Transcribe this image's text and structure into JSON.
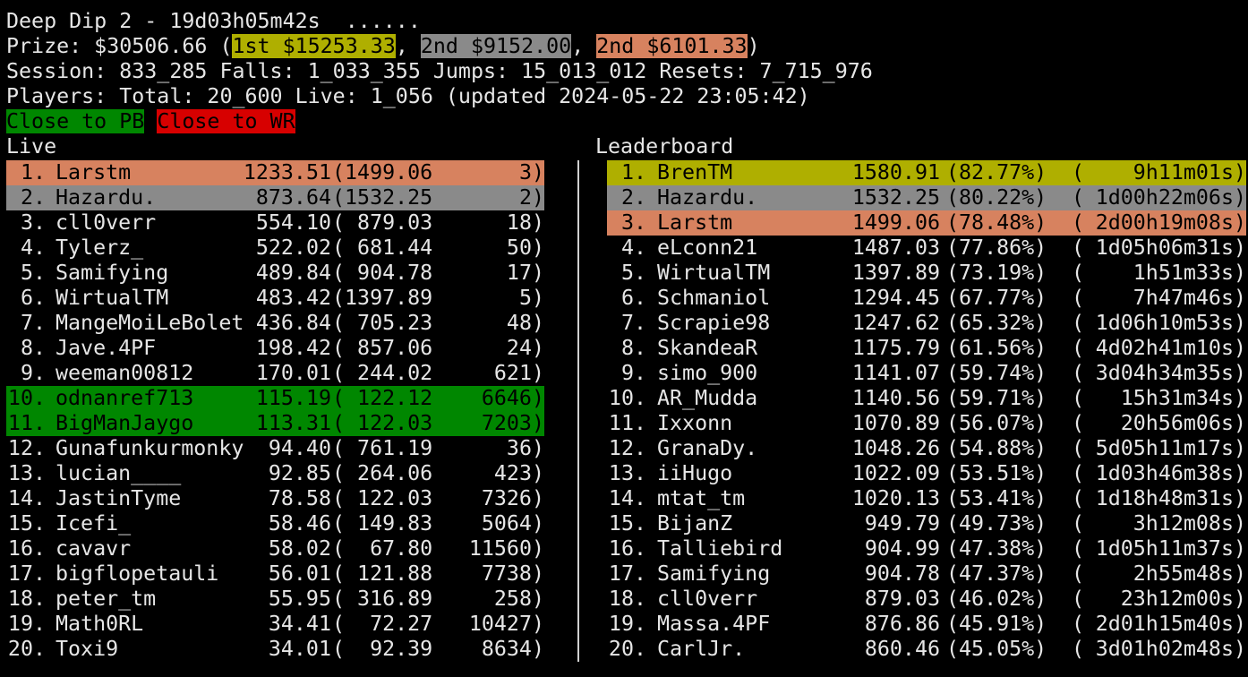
{
  "header": {
    "title": "Deep Dip 2 - 19d03h05m42s  ......",
    "prize_prefix": "Prize: $30506.66 (",
    "prize_first": "1st $15253.33",
    "prize_sep1": ", ",
    "prize_second": "2nd $9152.00",
    "prize_sep2": ", ",
    "prize_third": "2nd $6101.33",
    "prize_suffix": ")",
    "stats": "Session: 833_285 Falls: 1_033_355 Jumps: 15_013_012 Resets: 7_715_976",
    "players": "Players: Total: 20_600 Live: 1_056 (updated 2024-05-22 23:05:42)",
    "legend_pb": "Close to PB",
    "legend_wr": "Close to WR"
  },
  "colors": {
    "gold": "#afaf00",
    "silver": "#8a8a8a",
    "bronze": "#d7825f",
    "green": "#008700",
    "red": "#d70000",
    "text": "#e6e6e6",
    "background": "#000000"
  },
  "live": {
    "title": "Live",
    "rows": [
      {
        "rank": " 1.",
        "name": "Larstm",
        "height": "1233.51",
        "pb": "(1499.06",
        "falls": "3)",
        "highlight": "bronze"
      },
      {
        "rank": " 2.",
        "name": "Hazardu.",
        "height": "873.64",
        "pb": "(1532.25",
        "falls": "2)",
        "highlight": "silver"
      },
      {
        "rank": " 3.",
        "name": "cll0verr",
        "height": "554.10",
        "pb": "( 879.03",
        "falls": "18)",
        "highlight": ""
      },
      {
        "rank": " 4.",
        "name": "Tylerz_",
        "height": "522.02",
        "pb": "( 681.44",
        "falls": "50)",
        "highlight": ""
      },
      {
        "rank": " 5.",
        "name": "Samifying",
        "height": "489.84",
        "pb": "( 904.78",
        "falls": "17)",
        "highlight": ""
      },
      {
        "rank": " 6.",
        "name": "WirtualTM",
        "height": "483.42",
        "pb": "(1397.89",
        "falls": "5)",
        "highlight": ""
      },
      {
        "rank": " 7.",
        "name": "MangeMoiLeBolet",
        "height": "436.84",
        "pb": "( 705.23",
        "falls": "48)",
        "highlight": ""
      },
      {
        "rank": " 8.",
        "name": "Jave.4PF",
        "height": "198.42",
        "pb": "( 857.06",
        "falls": "24)",
        "highlight": ""
      },
      {
        "rank": " 9.",
        "name": "weeman00812",
        "height": "170.01",
        "pb": "( 244.02",
        "falls": "621)",
        "highlight": ""
      },
      {
        "rank": "10.",
        "name": "odnanref713",
        "height": "115.19",
        "pb": "( 122.12",
        "falls": "6646)",
        "highlight": "green"
      },
      {
        "rank": "11.",
        "name": "BigManJaygo",
        "height": "113.31",
        "pb": "( 122.03",
        "falls": "7203)",
        "highlight": "green"
      },
      {
        "rank": "12.",
        "name": "Gunafunkurmonky",
        "height": "94.40",
        "pb": "( 761.19",
        "falls": "36)",
        "highlight": ""
      },
      {
        "rank": "13.",
        "name": "lucian____",
        "height": "92.85",
        "pb": "( 264.06",
        "falls": "423)",
        "highlight": ""
      },
      {
        "rank": "14.",
        "name": "JastinTyme",
        "height": "78.58",
        "pb": "( 122.03",
        "falls": "7326)",
        "highlight": ""
      },
      {
        "rank": "15.",
        "name": "Icefi_",
        "height": "58.46",
        "pb": "( 149.83",
        "falls": "5064)",
        "highlight": ""
      },
      {
        "rank": "16.",
        "name": "cavavr",
        "height": "58.02",
        "pb": "(  67.80",
        "falls": "11560)",
        "highlight": ""
      },
      {
        "rank": "17.",
        "name": "bigflopetauli",
        "height": "56.01",
        "pb": "( 121.88",
        "falls": "7738)",
        "highlight": ""
      },
      {
        "rank": "18.",
        "name": "peter_tm",
        "height": "55.95",
        "pb": "( 316.89",
        "falls": "258)",
        "highlight": ""
      },
      {
        "rank": "19.",
        "name": "Math0RL",
        "height": "34.41",
        "pb": "(  72.27",
        "falls": "10427)",
        "highlight": ""
      },
      {
        "rank": "20.",
        "name": "Toxi9",
        "height": "34.01",
        "pb": "(  92.39",
        "falls": "8634)",
        "highlight": ""
      }
    ]
  },
  "leaderboard": {
    "title": "Leaderboard",
    "rows": [
      {
        "rank": " 1.",
        "name": "BrenTM",
        "height": "1580.91",
        "pct": "(82.77%)",
        "time_open": "(",
        "time": "9h11m01s)",
        "highlight": "gold"
      },
      {
        "rank": " 2.",
        "name": "Hazardu.",
        "height": "1532.25",
        "pct": "(80.22%)",
        "time_open": "(",
        "time": "1d00h22m06s)",
        "highlight": "silver"
      },
      {
        "rank": " 3.",
        "name": "Larstm",
        "height": "1499.06",
        "pct": "(78.48%)",
        "time_open": "(",
        "time": "2d00h19m08s)",
        "highlight": "bronze"
      },
      {
        "rank": " 4.",
        "name": "eLconn21",
        "height": "1487.03",
        "pct": "(77.86%)",
        "time_open": "(",
        "time": "1d05h06m31s)",
        "highlight": ""
      },
      {
        "rank": " 5.",
        "name": "WirtualTM",
        "height": "1397.89",
        "pct": "(73.19%)",
        "time_open": "(",
        "time": "1h51m33s)",
        "highlight": ""
      },
      {
        "rank": " 6.",
        "name": "Schmaniol",
        "height": "1294.45",
        "pct": "(67.77%)",
        "time_open": "(",
        "time": "7h47m46s)",
        "highlight": ""
      },
      {
        "rank": " 7.",
        "name": "Scrapie98",
        "height": "1247.62",
        "pct": "(65.32%)",
        "time_open": "(",
        "time": "1d06h10m53s)",
        "highlight": ""
      },
      {
        "rank": " 8.",
        "name": "SkandeaR",
        "height": "1175.79",
        "pct": "(61.56%)",
        "time_open": "(",
        "time": "4d02h41m10s)",
        "highlight": ""
      },
      {
        "rank": " 9.",
        "name": "simo_900",
        "height": "1141.07",
        "pct": "(59.74%)",
        "time_open": "(",
        "time": "3d04h34m35s)",
        "highlight": ""
      },
      {
        "rank": "10.",
        "name": "AR_Mudda",
        "height": "1140.56",
        "pct": "(59.71%)",
        "time_open": "(",
        "time": "15h31m34s)",
        "highlight": ""
      },
      {
        "rank": "11.",
        "name": "Ixxonn",
        "height": "1070.89",
        "pct": "(56.07%)",
        "time_open": "(",
        "time": "20h56m06s)",
        "highlight": ""
      },
      {
        "rank": "12.",
        "name": "GranaDy.",
        "height": "1048.26",
        "pct": "(54.88%)",
        "time_open": "(",
        "time": "5d05h11m17s)",
        "highlight": ""
      },
      {
        "rank": "13.",
        "name": "iiHugo",
        "height": "1022.09",
        "pct": "(53.51%)",
        "time_open": "(",
        "time": "1d03h46m38s)",
        "highlight": ""
      },
      {
        "rank": "14.",
        "name": "mtat_tm",
        "height": "1020.13",
        "pct": "(53.41%)",
        "time_open": "(",
        "time": "1d18h48m31s)",
        "highlight": ""
      },
      {
        "rank": "15.",
        "name": "BijanZ",
        "height": "949.79",
        "pct": "(49.73%)",
        "time_open": "(",
        "time": "3h12m08s)",
        "highlight": ""
      },
      {
        "rank": "16.",
        "name": "Talliebird",
        "height": "904.99",
        "pct": "(47.38%)",
        "time_open": "(",
        "time": "1d05h11m37s)",
        "highlight": ""
      },
      {
        "rank": "17.",
        "name": "Samifying",
        "height": "904.78",
        "pct": "(47.37%)",
        "time_open": "(",
        "time": "2h55m48s)",
        "highlight": ""
      },
      {
        "rank": "18.",
        "name": "cll0verr",
        "height": "879.03",
        "pct": "(46.02%)",
        "time_open": "(",
        "time": "23h12m00s)",
        "highlight": ""
      },
      {
        "rank": "19.",
        "name": "Massa.4PF",
        "height": "876.86",
        "pct": "(45.91%)",
        "time_open": "(",
        "time": "2d01h15m40s)",
        "highlight": ""
      },
      {
        "rank": "20.",
        "name": "CarlJr.",
        "height": "860.46",
        "pct": "(45.05%)",
        "time_open": "(",
        "time": "3d01h02m48s)",
        "highlight": ""
      }
    ]
  }
}
